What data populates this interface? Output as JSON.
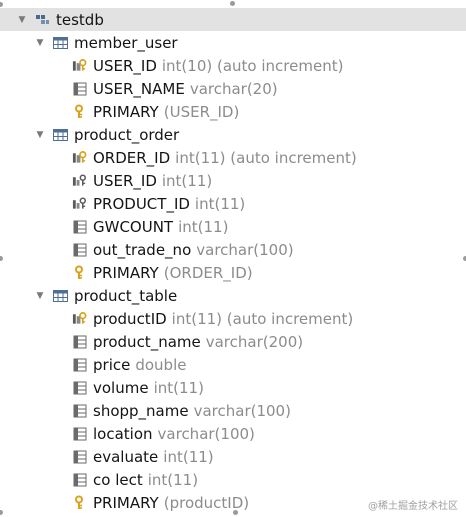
{
  "tree": {
    "database": {
      "label": "testdb"
    },
    "tables": [
      {
        "label": "member_user",
        "columns": [
          {
            "name": "USER_ID",
            "type": "int(10) (auto increment)",
            "icon": "primary-key-column-icon"
          },
          {
            "name": "USER_NAME",
            "type": "varchar(20)",
            "icon": "column-icon"
          }
        ],
        "index": {
          "name": "PRIMARY",
          "cols": "(USER_ID)"
        }
      },
      {
        "label": "product_order",
        "columns": [
          {
            "name": "ORDER_ID",
            "type": "int(11) (auto increment)",
            "icon": "primary-key-column-icon"
          },
          {
            "name": "USER_ID",
            "type": "int(11)",
            "icon": "foreign-key-column-icon"
          },
          {
            "name": "PRODUCT_ID",
            "type": "int(11)",
            "icon": "foreign-key-column-icon"
          },
          {
            "name": "GWCOUNT",
            "type": "int(11)",
            "icon": "column-icon"
          },
          {
            "name": "out_trade_no",
            "type": "varchar(100)",
            "icon": "column-icon"
          }
        ],
        "index": {
          "name": "PRIMARY",
          "cols": "(ORDER_ID)"
        }
      },
      {
        "label": "product_table",
        "columns": [
          {
            "name": "productID",
            "type": "int(11) (auto increment)",
            "icon": "primary-key-column-icon"
          },
          {
            "name": "product_name",
            "type": "varchar(200)",
            "icon": "column-icon"
          },
          {
            "name": "price",
            "type": "double",
            "icon": "column-icon"
          },
          {
            "name": "volume",
            "type": "int(11)",
            "icon": "column-icon"
          },
          {
            "name": "shopp_name",
            "type": "varchar(100)",
            "icon": "column-icon"
          },
          {
            "name": "location",
            "type": "varchar(100)",
            "icon": "column-icon"
          },
          {
            "name": "evaluate",
            "type": "int(11)",
            "icon": "column-icon"
          },
          {
            "name": "co lect",
            "type": "int(11)",
            "icon": "column-icon"
          }
        ],
        "index": {
          "name": "PRIMARY",
          "cols": "(productID)"
        }
      }
    ]
  },
  "watermark": "@稀土掘金技术社区",
  "colors": {
    "selected_row": "#e2e2e2",
    "type_text": "#8c8c8c",
    "key_gold": "#d9a21a",
    "table_blue": "#5b7fa6"
  }
}
